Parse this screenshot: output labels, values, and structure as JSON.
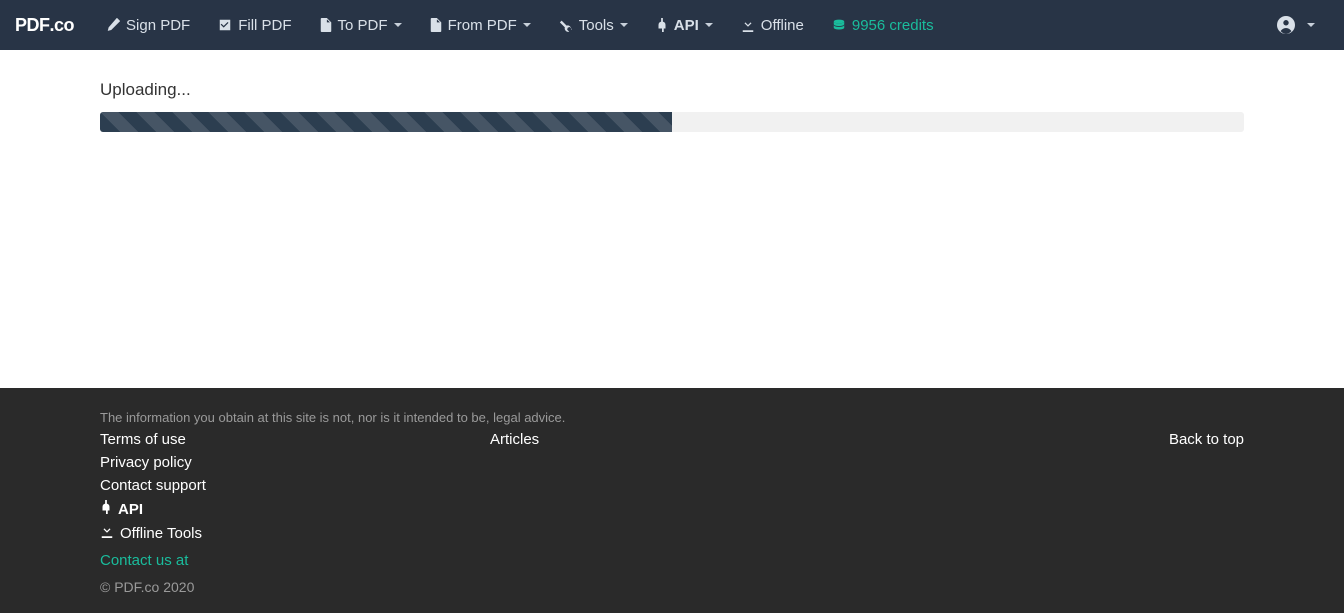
{
  "brand": {
    "bold": "PDF",
    "rest": ".co"
  },
  "nav": {
    "sign": {
      "label": "Sign PDF"
    },
    "fill": {
      "label": "Fill PDF"
    },
    "to": {
      "label": "To PDF"
    },
    "from": {
      "label": "From PDF"
    },
    "tools": {
      "label": "Tools"
    },
    "api": {
      "label": "API"
    },
    "offline": {
      "label": "Offline"
    },
    "credits": {
      "label": "9956 credits"
    }
  },
  "main": {
    "status": "Uploading...",
    "progress_percent": 50
  },
  "footer": {
    "disclaimer": "The information you obtain at this site is not, nor is it intended to be, legal advice.",
    "links1": {
      "terms": "Terms of use",
      "privacy": "Privacy policy",
      "support": "Contact support",
      "api": "API",
      "offline": "Offline Tools"
    },
    "links2": {
      "articles": "Articles"
    },
    "back_to_top": "Back to top",
    "contact": "Contact us at",
    "copyright": "© PDF.co 2020"
  }
}
